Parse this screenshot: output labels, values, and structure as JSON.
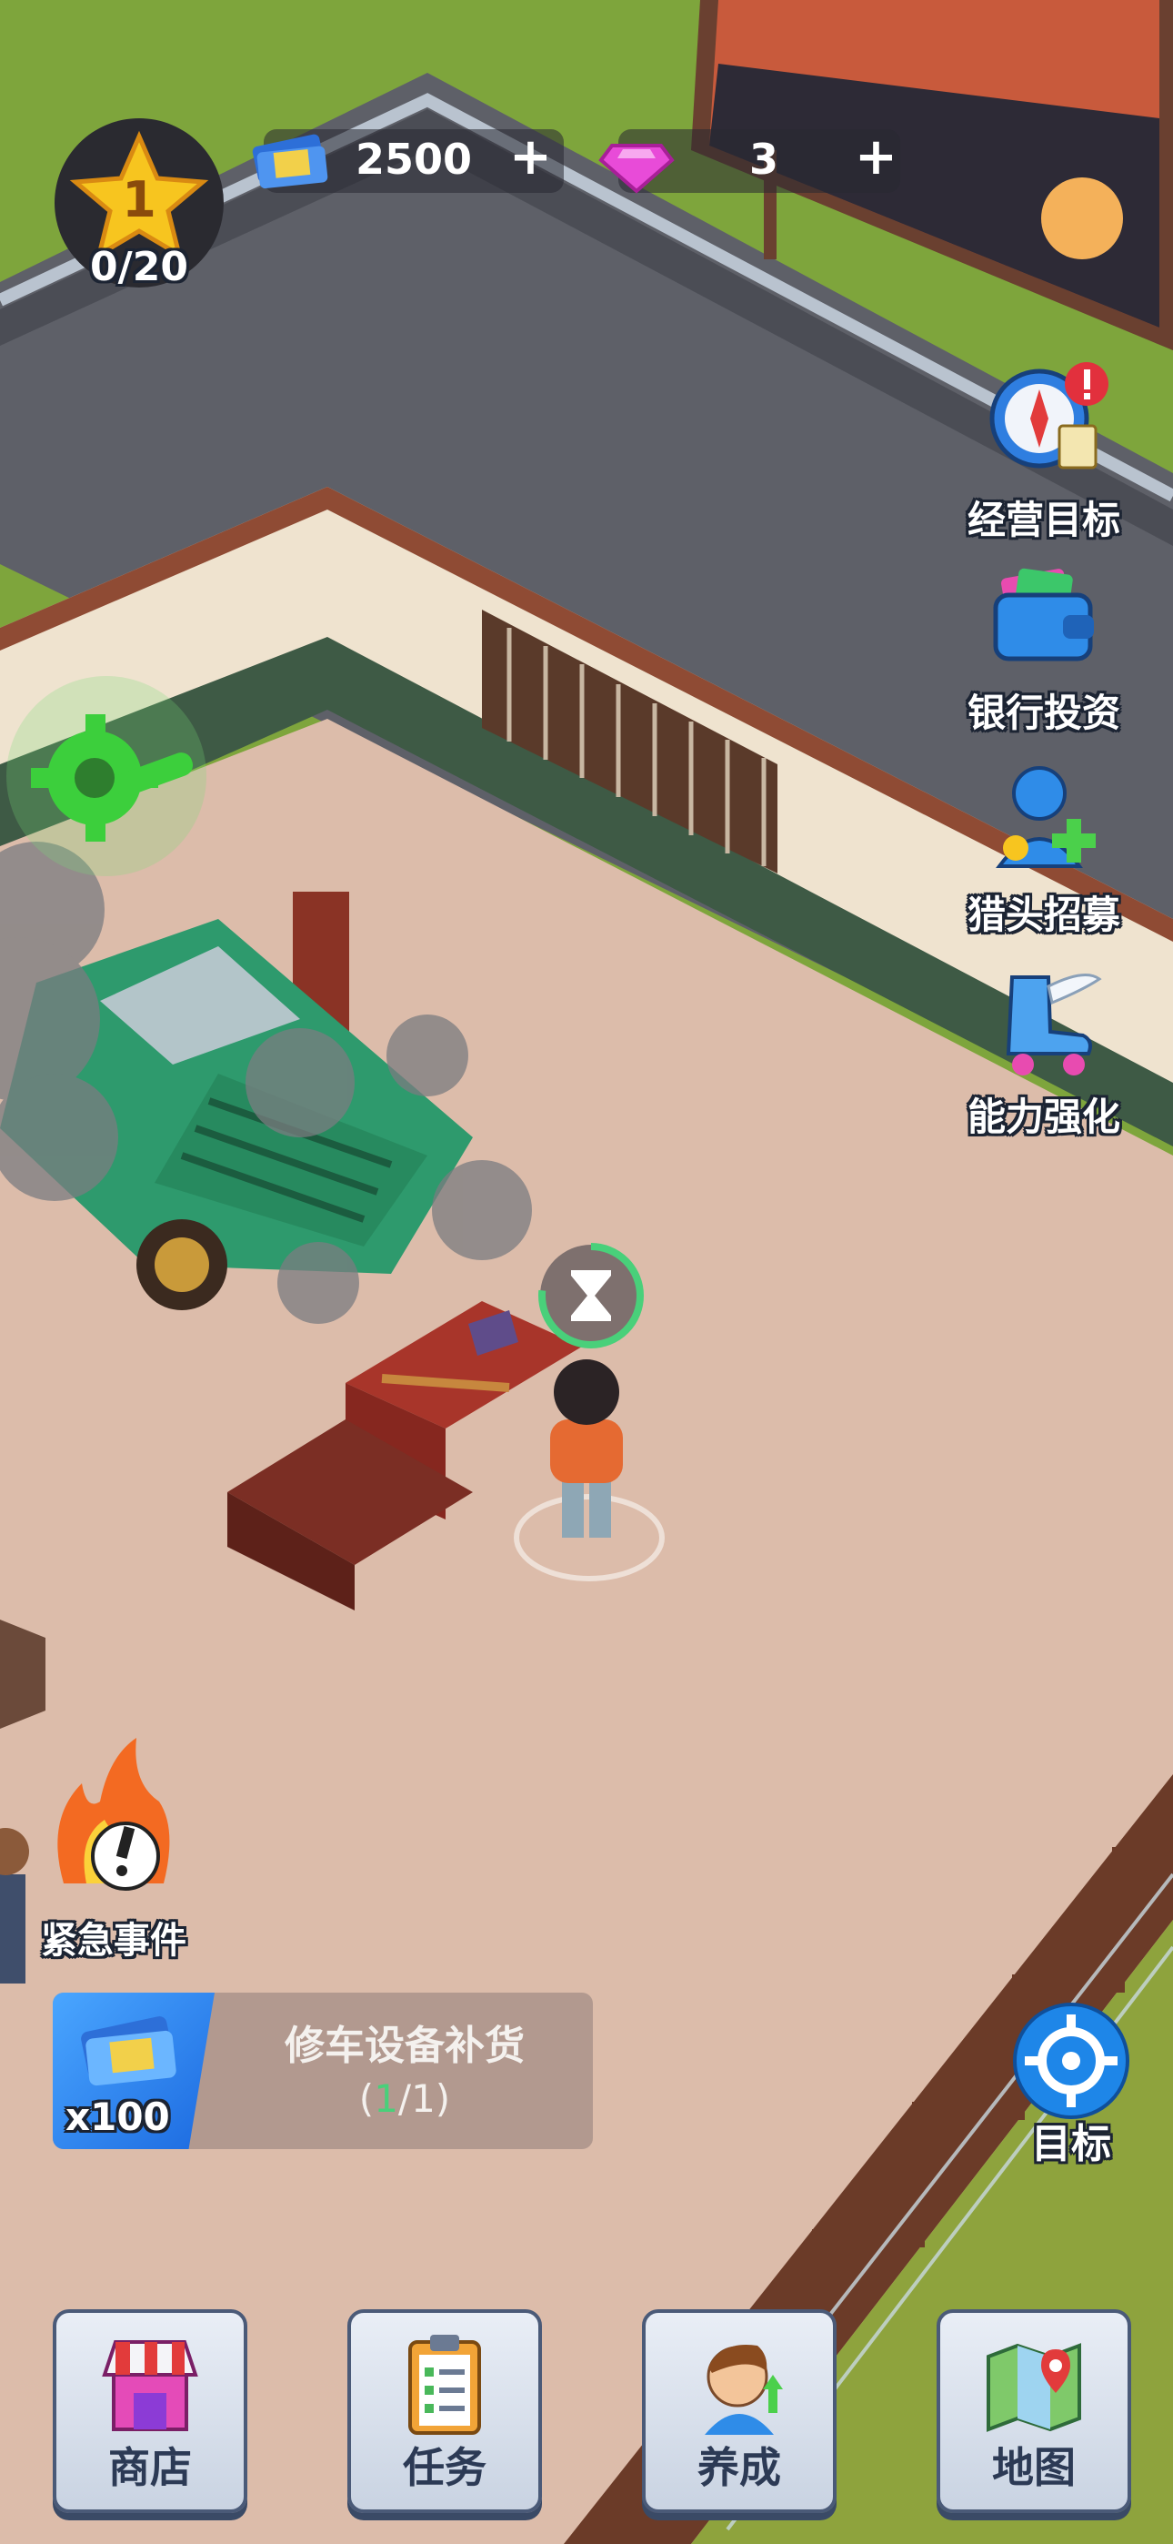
{
  "hud": {
    "level": "1",
    "xp_progress": "0/20",
    "cash": "2500",
    "gems": "3",
    "plus_symbol": "+"
  },
  "side_menu": [
    {
      "label": "经营目标",
      "icon": "compass-icon",
      "has_alert": true
    },
    {
      "label": "银行投资",
      "icon": "wallet-icon"
    },
    {
      "label": "猎头招募",
      "icon": "recruit-icon"
    },
    {
      "label": "能力强化",
      "icon": "winged-skate-icon"
    }
  ],
  "urgent_event": {
    "label": "紧急事件",
    "icon": "fire-alert-icon"
  },
  "task_card": {
    "title": "修车设备补货",
    "reward": "x100",
    "progress_current": "1",
    "progress_total": "/1",
    "progress_open": "(",
    "progress_close": ")"
  },
  "target_button": {
    "label": "目标"
  },
  "bottom_nav": [
    {
      "label": "商店",
      "icon": "shop-icon"
    },
    {
      "label": "任务",
      "icon": "clipboard-icon"
    },
    {
      "label": "养成",
      "icon": "character-icon"
    },
    {
      "label": "地图",
      "icon": "map-icon"
    }
  ],
  "colors": {
    "accent_green": "#3ccf3c",
    "cash_blue": "#2d6fd8",
    "gem_pink": "#e84bd8",
    "progress_green": "#49d07a"
  }
}
